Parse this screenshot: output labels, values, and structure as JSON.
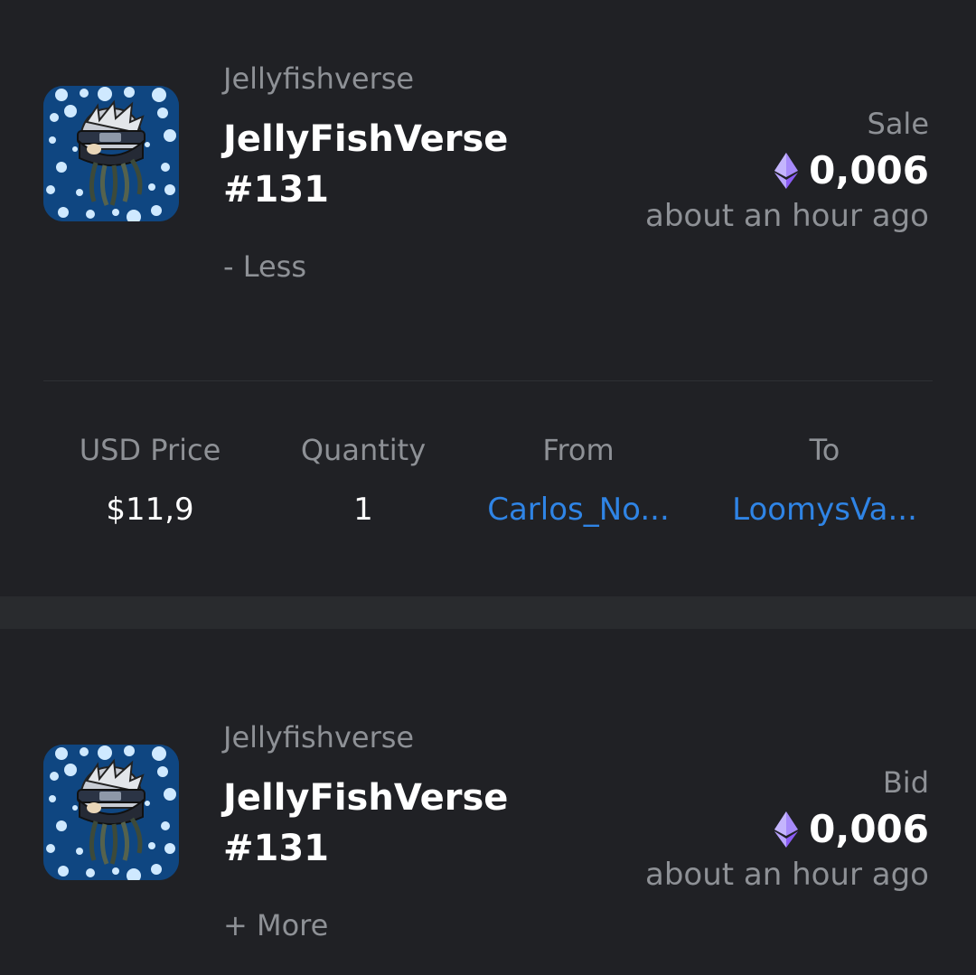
{
  "colors": {
    "background": "#202125",
    "muted_text": "#8e9196",
    "link": "#2f84e5",
    "eth": "#a78bfa"
  },
  "activities": [
    {
      "collection": "Jellyfishverse",
      "title_line1": "JellyFishVerse",
      "title_line2": "#131",
      "toggle": "- Less",
      "event_type": "Sale",
      "price": "0,006",
      "time": "about an hour ago",
      "details": {
        "headers": [
          "USD Price",
          "Quantity",
          "From",
          "To"
        ],
        "usd_price": "$11,9",
        "quantity": "1",
        "from": "Carlos_No...",
        "to": "LoomysVa..."
      }
    },
    {
      "collection": "Jellyfishverse",
      "title_line1": "JellyFishVerse",
      "title_line2": "#131",
      "toggle": "+ More",
      "event_type": "Bid",
      "price": "0,006",
      "time": "about an hour ago"
    }
  ],
  "icons": {
    "currency": "ethereum-icon",
    "thumbnail": "nft-thumbnail"
  }
}
